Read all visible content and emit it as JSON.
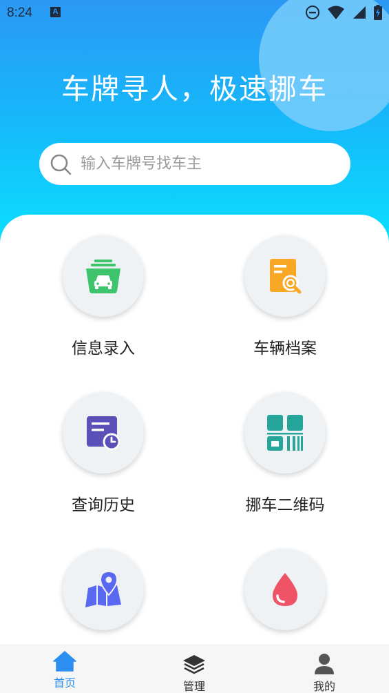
{
  "status_bar": {
    "time": "8:24",
    "notification_glyph": "A",
    "icons": [
      "dnd-icon",
      "wifi-icon",
      "signal-icon",
      "battery-icon"
    ]
  },
  "hero": {
    "headline": "车牌寻人，极速挪车",
    "search": {
      "placeholder": "输入车牌号找车主",
      "value": ""
    }
  },
  "grid": {
    "items": [
      {
        "label": "信息录入",
        "icon": "car-basket-icon",
        "color": "#3ec46d"
      },
      {
        "label": "车辆档案",
        "icon": "document-search-icon",
        "color": "#f9a825"
      },
      {
        "label": "查询历史",
        "icon": "history-clock-icon",
        "color": "#5b4fb8"
      },
      {
        "label": "挪车二维码",
        "icon": "qr-code-icon",
        "color": "#26a69a"
      },
      {
        "label": "",
        "icon": "map-pin-icon",
        "color": "#5a67f0"
      },
      {
        "label": "",
        "icon": "drop-icon",
        "color": "#ef5366"
      }
    ]
  },
  "tabbar": {
    "tabs": [
      {
        "label": "首页",
        "icon": "home-icon",
        "active": true
      },
      {
        "label": "管理",
        "icon": "layers-icon",
        "active": false
      },
      {
        "label": "我的",
        "icon": "person-icon",
        "active": false
      }
    ],
    "active_color": "#2b8ef0",
    "inactive_color": "#333333"
  }
}
